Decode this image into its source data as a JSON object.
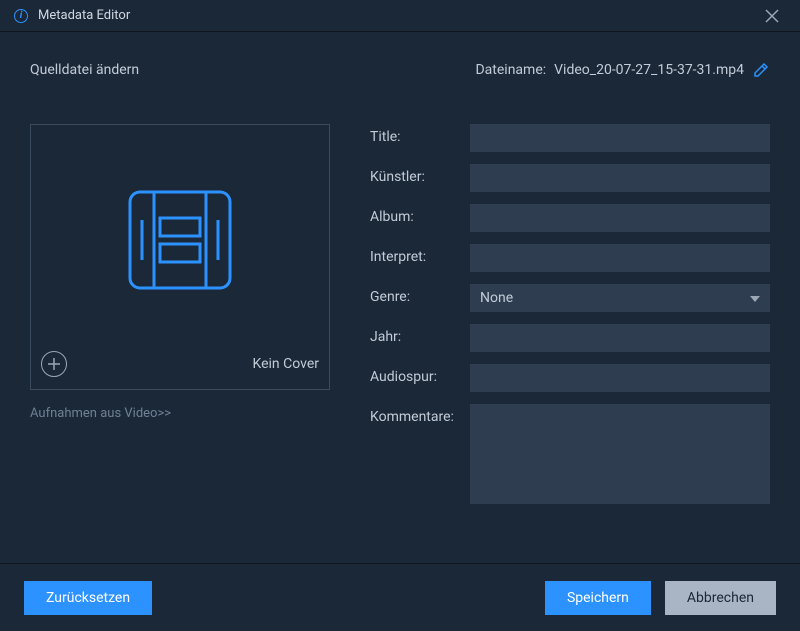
{
  "titlebar": {
    "title": "Metadata Editor"
  },
  "header": {
    "change_source": "Quelldatei ändern",
    "filename_label": "Dateiname:",
    "filename": "Video_20-07-27_15-37-31.mp4"
  },
  "cover": {
    "no_cover": "Kein Cover",
    "capture_link": "Aufnahmen aus Video>>"
  },
  "fields": {
    "title_label": "Title:",
    "title_value": "",
    "artist_label": "Künstler:",
    "artist_value": "",
    "album_label": "Album:",
    "album_value": "",
    "interpret_label": "Interpret:",
    "interpret_value": "",
    "genre_label": "Genre:",
    "genre_value": "None",
    "year_label": "Jahr:",
    "year_value": "",
    "audiotrack_label": "Audiospur:",
    "audiotrack_value": "",
    "comments_label": "Kommentare:",
    "comments_value": ""
  },
  "footer": {
    "reset": "Zurücksetzen",
    "save": "Speichern",
    "cancel": "Abbrechen"
  }
}
